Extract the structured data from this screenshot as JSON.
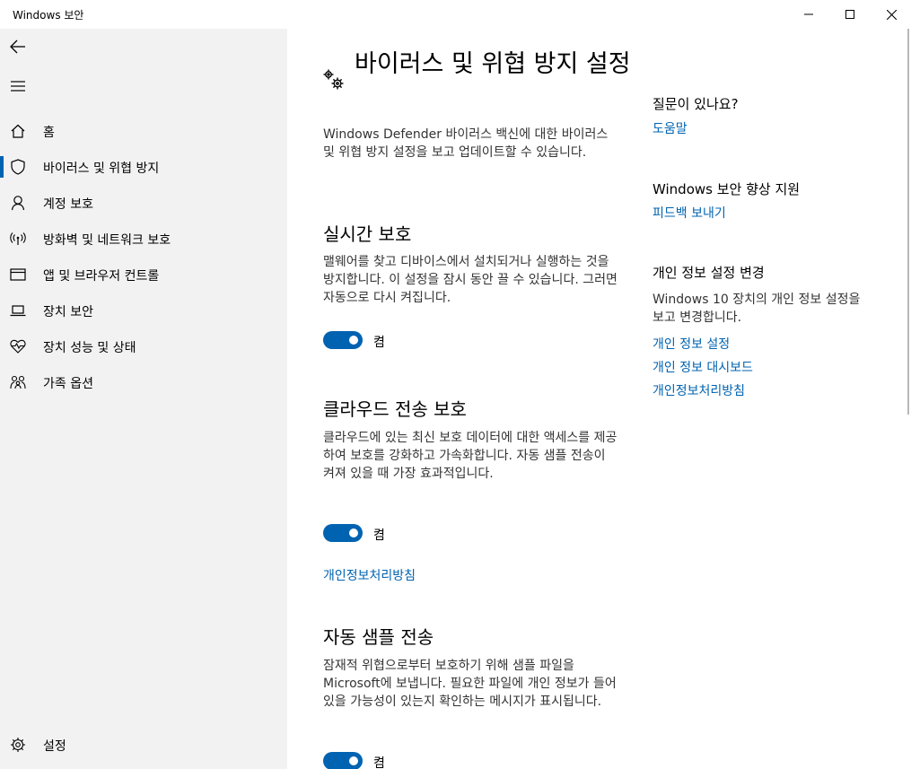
{
  "window": {
    "title": "Windows 보안"
  },
  "sidebar": {
    "items": [
      {
        "label": "홈",
        "icon": "home-icon"
      },
      {
        "label": "바이러스 및 위협 방지",
        "icon": "shield-icon",
        "selected": true
      },
      {
        "label": "계정 보호",
        "icon": "person-icon"
      },
      {
        "label": "방화벽 및 네트워크 보호",
        "icon": "wireless-icon"
      },
      {
        "label": "앱 및 브라우저 컨트롤",
        "icon": "browser-window-icon"
      },
      {
        "label": "장치 보안",
        "icon": "laptop-icon"
      },
      {
        "label": "장치 성능 및 상태",
        "icon": "heart-pulse-icon"
      },
      {
        "label": "가족 옵션",
        "icon": "family-icon"
      }
    ],
    "settings_label": "설정"
  },
  "main": {
    "title": "바이러스 및 위협 방지 설정",
    "intro": "Windows Defender 바이러스 백신에 대한 바이러스 및 위협 방지 설정을 보고 업데이트할 수 있습니다.",
    "sections": [
      {
        "title": "실시간 보호",
        "description": "맬웨어를 찾고 디바이스에서 설치되거나 실행하는 것을 방지합니다. 이 설정을 잠시 동안 끌 수 있습니다. 그러면 자동으로 다시 켜집니다.",
        "toggle_label": "켬",
        "toggle_on": true
      },
      {
        "title": "클라우드 전송 보호",
        "description": "클라우드에 있는 최신 보호 데이터에 대한 액세스를 제공하여 보호를 강화하고 가속화합니다. 자동 샘플 전송이 켜져 있을 때 가장 효과적입니다.",
        "toggle_label": "켬",
        "toggle_on": true,
        "link": "개인정보처리방침"
      },
      {
        "title": "자동 샘플 전송",
        "description": "잠재적 위협으로부터 보호하기 위해 샘플 파일을 Microsoft에 보냅니다. 필요한 파일에 개인 정보가 들어 있을 가능성이 있는지 확인하는 메시지가 표시됩니다.",
        "toggle_label": "켬",
        "toggle_on": true
      }
    ]
  },
  "right": {
    "help_heading": "질문이 있나요?",
    "help_link": "도움말",
    "improve_heading": "Windows 보안 향상 지원",
    "feedback_link": "피드백 보내기",
    "privacy_heading": "개인 정보 설정 변경",
    "privacy_text": "Windows 10 장치의 개인 정보 설정을 보고 변경합니다.",
    "privacy_links": [
      "개인 정보 설정",
      "개인 정보 대시보드",
      "개인정보처리방침"
    ]
  },
  "colors": {
    "accent": "#0063b1",
    "sidebar_bg": "#f2f2f2"
  }
}
